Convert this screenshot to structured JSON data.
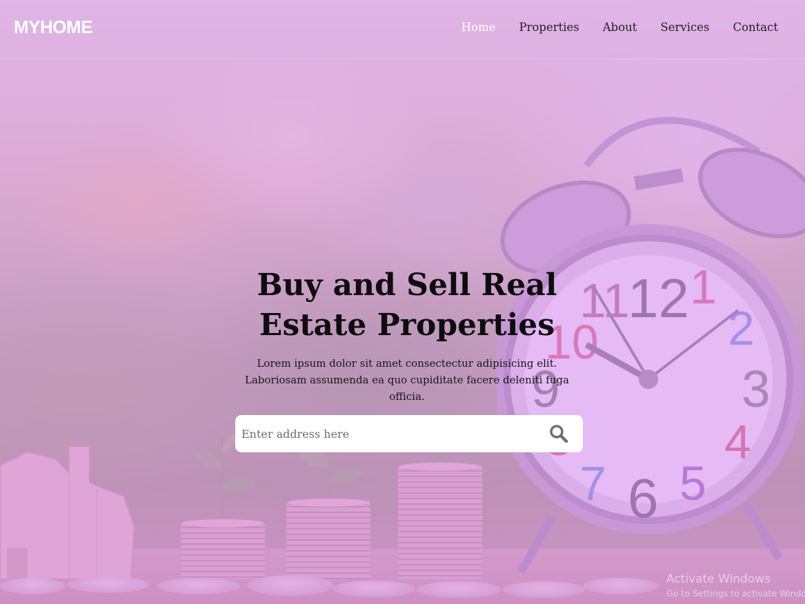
{
  "brand": "MYHOME",
  "nav": {
    "items": [
      {
        "label": "Home",
        "active": true
      },
      {
        "label": "Properties",
        "active": false
      },
      {
        "label": "About",
        "active": false
      },
      {
        "label": "Services",
        "active": false
      },
      {
        "label": "Contact",
        "active": false
      }
    ]
  },
  "hero": {
    "title_line1": "Buy and Sell Real",
    "title_line2": "Estate Properties",
    "description": "Lorem ipsum dolor sit amet consectectur adipisicing elit. Laboriosam assumenda ea quo cupiditate facere deleniti fuga officia."
  },
  "search": {
    "placeholder": "Enter address here",
    "value": "",
    "icon": "search-icon"
  },
  "watermark": {
    "title": "Activate Windows",
    "subtitle": "Go to Settings to activate Windows."
  },
  "colors": {
    "overlay": "#db99f5",
    "nav_active": "#ffffff",
    "nav_text": "#222222",
    "title_text": "#0d0d0d"
  }
}
